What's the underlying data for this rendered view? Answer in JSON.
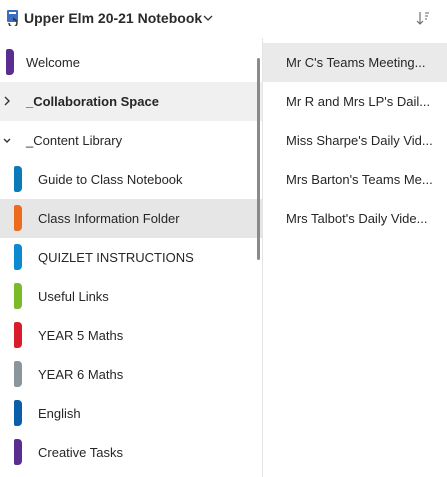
{
  "header": {
    "notebook_title": "Upper Elm 20-21 Notebook",
    "notebook_icon": "onenote-sync-icon",
    "chevron_icon": "chevron-down-icon",
    "sort_icon": "sort-icon"
  },
  "sections": [
    {
      "label": "Welcome",
      "color": "#5b2d90",
      "type": "section",
      "selected": false
    },
    {
      "label": "_Collaboration Space",
      "type": "group",
      "expanded": false,
      "bold": true
    },
    {
      "label": "_Content Library",
      "type": "group",
      "expanded": true,
      "bold": false
    },
    {
      "label": "Guide to Class Notebook",
      "color": "#0c7ab8",
      "type": "section",
      "indent": true
    },
    {
      "label": "Class Information Folder",
      "color": "#ee6a1f",
      "type": "section",
      "indent": true,
      "selected": true
    },
    {
      "label": "QUIZLET INSTRUCTIONS",
      "color": "#0c8ad1",
      "type": "section",
      "indent": true
    },
    {
      "label": "Useful Links",
      "color": "#7bbb2a",
      "type": "section",
      "indent": true
    },
    {
      "label": "YEAR 5 Maths",
      "color": "#d91c2b",
      "type": "section",
      "indent": true
    },
    {
      "label": "YEAR 6 Maths",
      "color": "#8a959c",
      "type": "section",
      "indent": true
    },
    {
      "label": "English",
      "color": "#0b5ea8",
      "type": "section",
      "indent": true
    },
    {
      "label": "Creative Tasks",
      "color": "#5b2d90",
      "type": "section",
      "indent": true
    }
  ],
  "pages": [
    {
      "label": "Mr C's Teams Meeting...",
      "selected": true
    },
    {
      "label": "Mr R and Mrs LP's Dail...",
      "selected": false
    },
    {
      "label": "Miss Sharpe's Daily Vid...",
      "selected": false
    },
    {
      "label": "Mrs Barton's Teams Me...",
      "selected": false
    },
    {
      "label": "Mrs Talbot's Daily Vide...",
      "selected": false
    }
  ]
}
